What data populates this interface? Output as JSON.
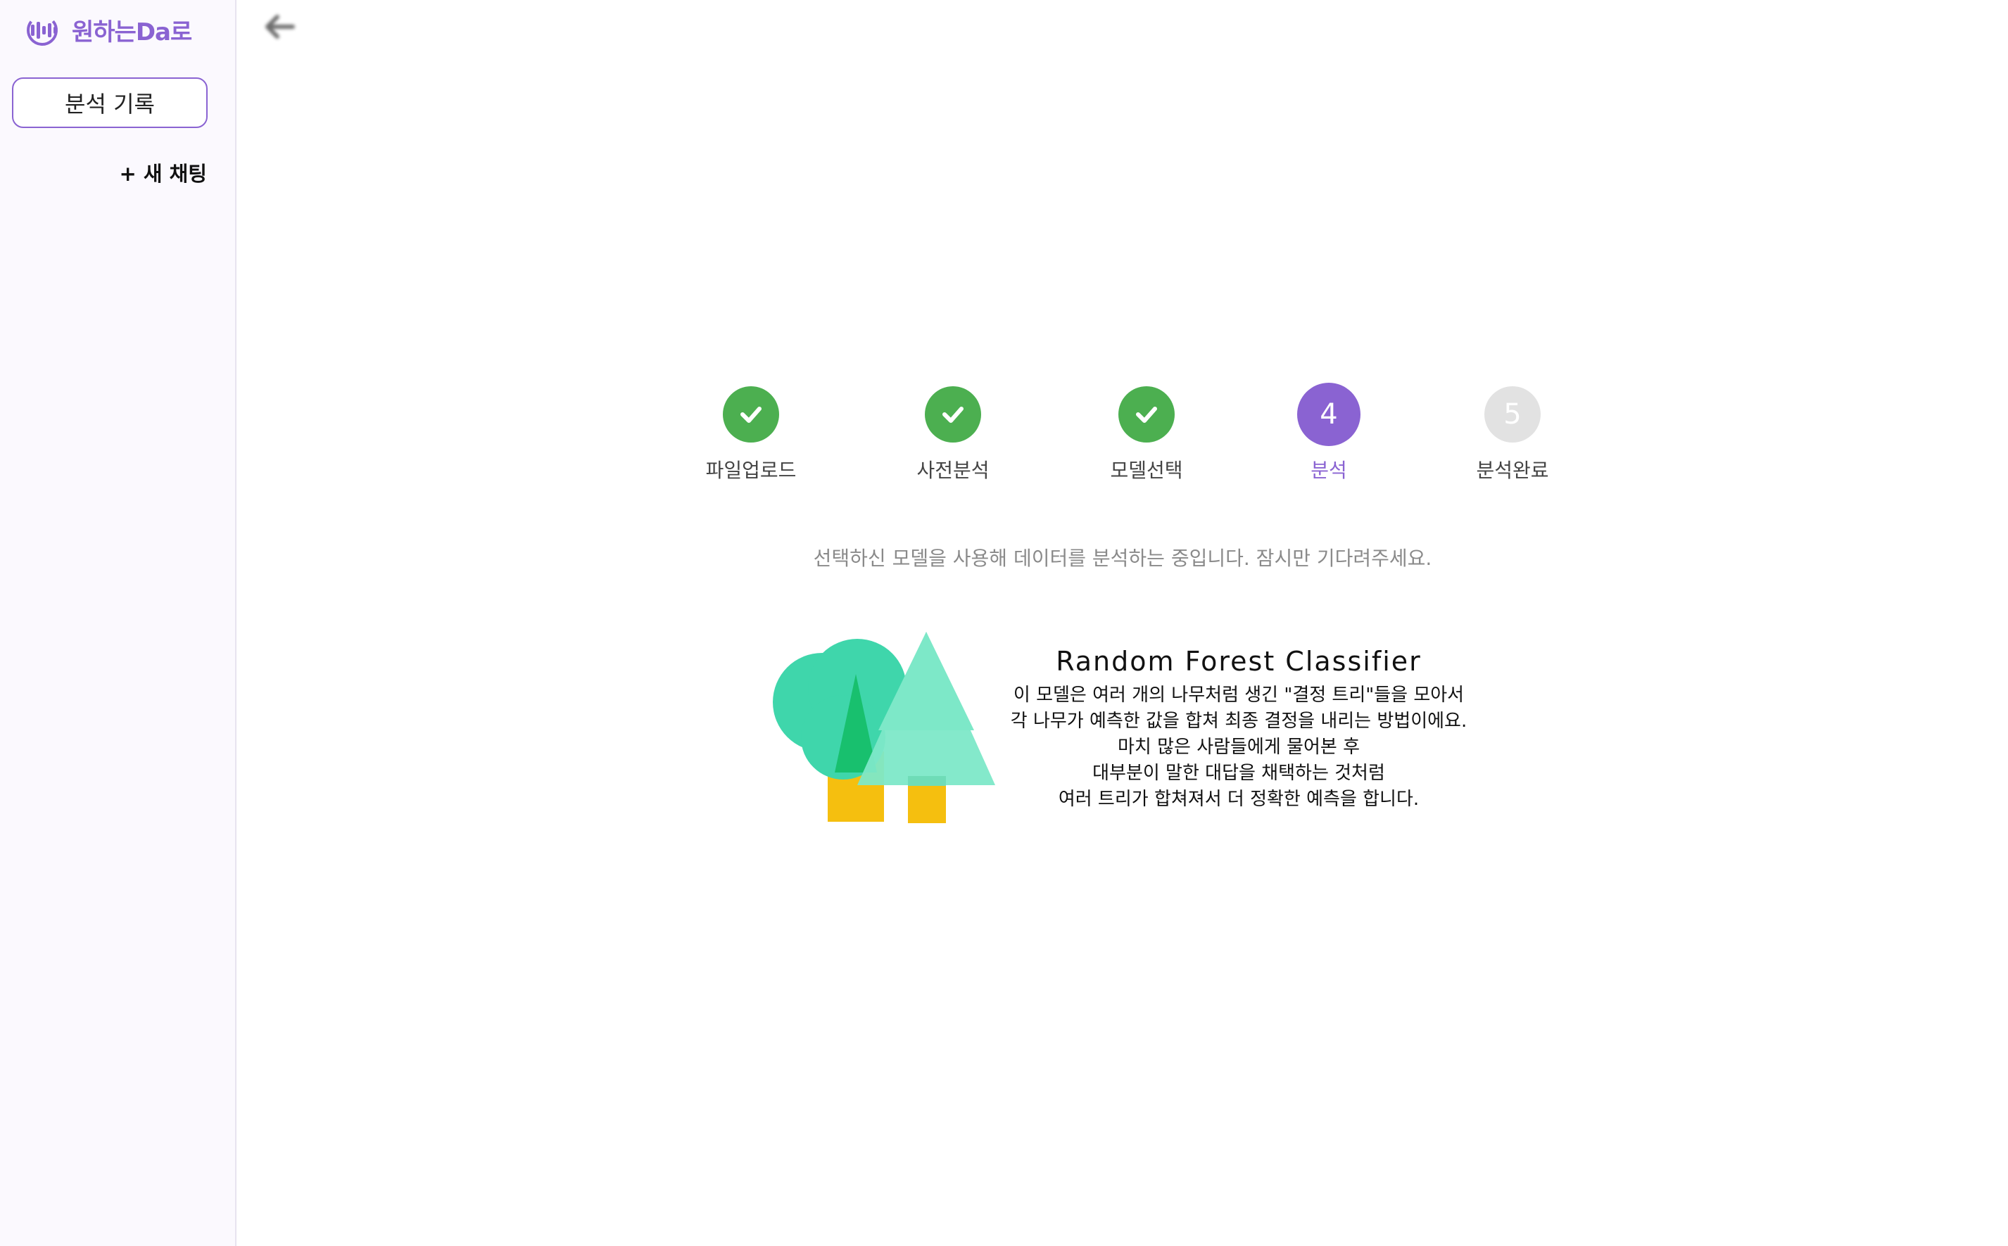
{
  "app": {
    "title": "원하는Da로"
  },
  "sidebar": {
    "history_label": "분석 기록",
    "new_chat_label": "+ 새 채팅"
  },
  "colors": {
    "accent": "#8a63d2",
    "done": "#4caf50",
    "pending": "#e2e2e2"
  },
  "stepper": {
    "steps": [
      {
        "label": "파일업로드",
        "state": "done",
        "icon": "check-icon"
      },
      {
        "label": "사전분석",
        "state": "done",
        "icon": "check-icon"
      },
      {
        "label": "모델선택",
        "state": "done",
        "icon": "check-icon"
      },
      {
        "label": "분석",
        "state": "active",
        "number": "4"
      },
      {
        "label": "분석완료",
        "state": "pending",
        "number": "5"
      }
    ]
  },
  "status_message": "선택하신 모델을 사용해 데이터를 분석하는 중입니다. 잠시만 기다려주세요.",
  "model": {
    "name": "Random Forest Classifier",
    "description_lines": [
      "이 모델은 여러 개의 나무처럼 생긴 \"결정 트리\"들을 모아서",
      "각 나무가 예측한 값을 합쳐 최종 결정을 내리는 방법이에요.",
      "마치 많은 사람들에게 물어본 후",
      "대부분이 말한 대답을 채택하는 것처럼",
      "여러 트리가 합쳐져서 더 정확한 예측을 합니다."
    ]
  }
}
